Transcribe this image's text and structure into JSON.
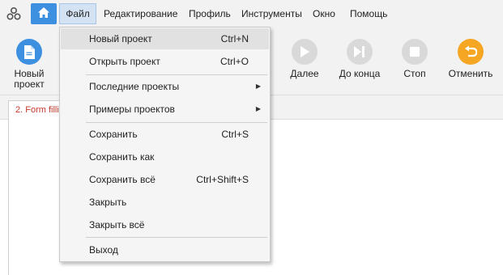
{
  "menubar": {
    "items": [
      "Файл",
      "Редактирование",
      "Профиль",
      "Инструменты",
      "Окно",
      "Помощь"
    ]
  },
  "toolbar": {
    "new_project": "Новый проект",
    "next": "Далее",
    "to_end": "До конца",
    "stop": "Стоп",
    "undo": "Отменить"
  },
  "tab": {
    "label": "2. Form filling"
  },
  "file_menu": {
    "items": [
      {
        "label": "Новый проект",
        "shortcut": "Ctrl+N"
      },
      {
        "label": "Открыть проект",
        "shortcut": "Ctrl+O"
      },
      {
        "label": "Последние проекты",
        "shortcut": ""
      },
      {
        "label": "Примеры проектов",
        "shortcut": ""
      },
      {
        "label": "Сохранить",
        "shortcut": "Ctrl+S"
      },
      {
        "label": "Сохранить как",
        "shortcut": ""
      },
      {
        "label": "Сохранить всё",
        "shortcut": "Ctrl+Shift+S"
      },
      {
        "label": "Закрыть",
        "shortcut": ""
      },
      {
        "label": "Закрыть всё",
        "shortcut": ""
      },
      {
        "label": "Выход",
        "shortcut": ""
      }
    ]
  },
  "colors": {
    "accent": "#3d8fe0",
    "undo": "#f5a623",
    "disabled": "#d9d9d9",
    "tab_text": "#c0392b"
  }
}
